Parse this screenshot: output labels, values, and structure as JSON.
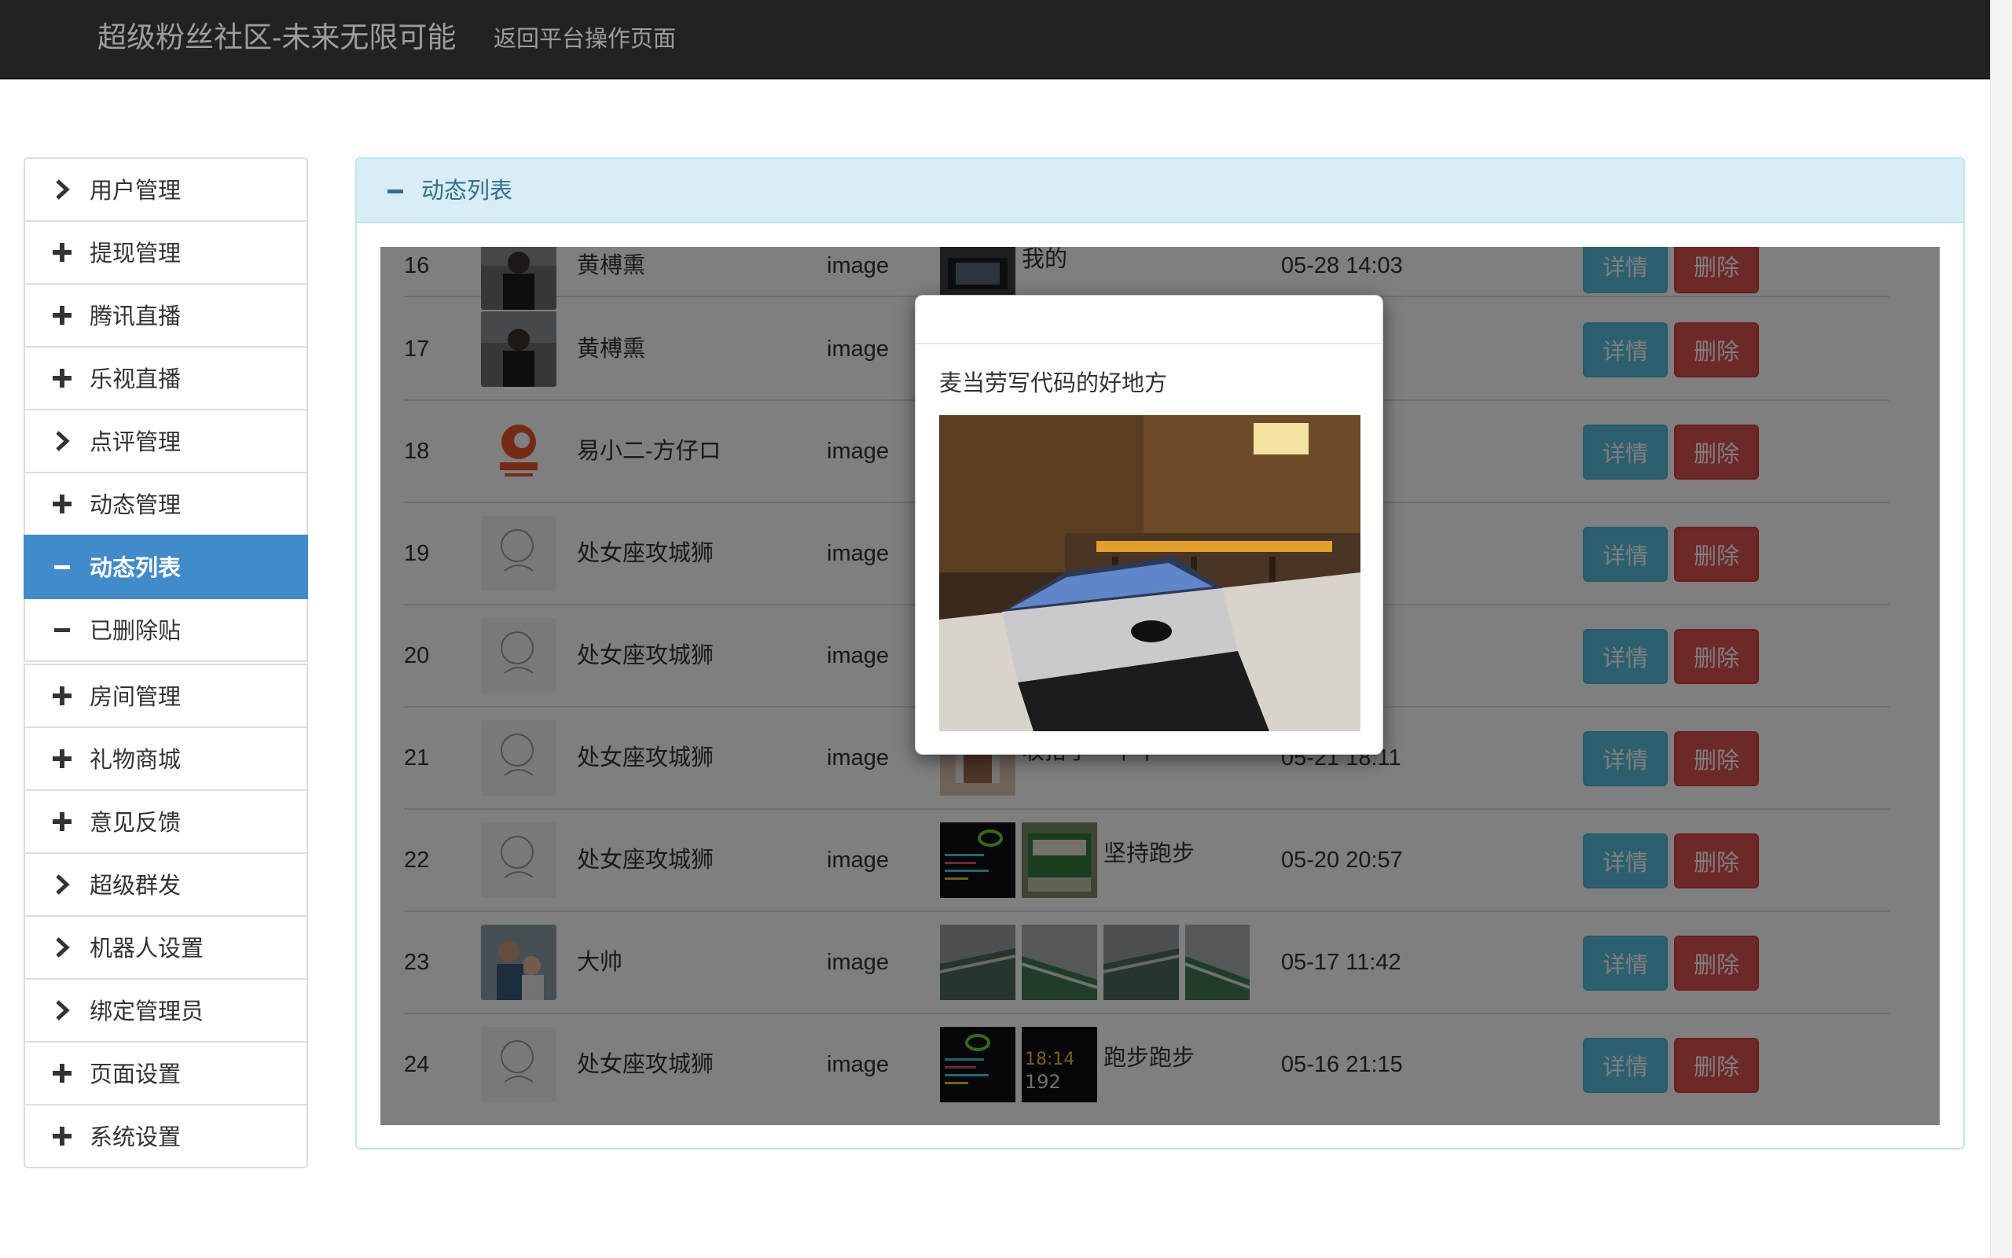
{
  "header": {
    "brand": "超级粉丝社区-未来无限可能",
    "back_link": "返回平台操作页面"
  },
  "sidebar": {
    "items": [
      {
        "label": "用户管理",
        "icon": "chevron-right-icon"
      },
      {
        "label": "提现管理",
        "icon": "plus-icon"
      },
      {
        "label": "腾讯直播",
        "icon": "plus-icon"
      },
      {
        "label": "乐视直播",
        "icon": "plus-icon"
      },
      {
        "label": "点评管理",
        "icon": "chevron-right-icon"
      },
      {
        "label": "动态管理",
        "icon": "plus-icon"
      },
      {
        "label": "动态列表",
        "icon": "minus-icon",
        "active": true
      },
      {
        "label": "已删除贴",
        "icon": "minus-icon"
      },
      {
        "label": "房间管理",
        "icon": "plus-icon"
      },
      {
        "label": "礼物商城",
        "icon": "plus-icon"
      },
      {
        "label": "意见反馈",
        "icon": "plus-icon"
      },
      {
        "label": "超级群发",
        "icon": "chevron-right-icon"
      },
      {
        "label": "机器人设置",
        "icon": "chevron-right-icon"
      },
      {
        "label": "绑定管理员",
        "icon": "chevron-right-icon"
      },
      {
        "label": "页面设置",
        "icon": "plus-icon"
      },
      {
        "label": "系统设置",
        "icon": "plus-icon"
      }
    ]
  },
  "panel": {
    "title": "动态列表"
  },
  "buttons": {
    "detail": "详情",
    "delete": "删除"
  },
  "rows": [
    {
      "id": "16",
      "name": "黄榑熏",
      "type": "image",
      "text": "我的",
      "time": "05-28 14:03",
      "thumbs": 1
    },
    {
      "id": "17",
      "name": "黄榑熏",
      "type": "image",
      "text": "",
      "time": "",
      "thumbs": 0
    },
    {
      "id": "18",
      "name": "易小二-方仔ロ",
      "type": "image",
      "text": "",
      "time": "",
      "thumbs": 0
    },
    {
      "id": "19",
      "name": "处女座攻城狮",
      "type": "image",
      "text": "",
      "time": "",
      "thumbs": 0
    },
    {
      "id": "20",
      "name": "处女座攻城狮",
      "type": "image",
      "text": "",
      "time": "",
      "thumbs": 0
    },
    {
      "id": "21",
      "name": "处女座攻城狮",
      "type": "image",
      "text": "收拾了一下午",
      "time": "05-21 18:11",
      "thumbs": 1
    },
    {
      "id": "22",
      "name": "处女座攻城狮",
      "type": "image",
      "text": "坚持跑步",
      "time": "05-20 20:57",
      "thumbs": 2
    },
    {
      "id": "23",
      "name": "大帅",
      "type": "image",
      "text": "",
      "time": "05-17 11:42",
      "thumbs": 4
    },
    {
      "id": "24",
      "name": "处女座攻城狮",
      "type": "image",
      "text": "跑步跑步",
      "time": "05-16 21:15",
      "thumbs": 2
    }
  ],
  "modal": {
    "text": "麦当劳写代码的好地方"
  },
  "thumb_texts": {
    "watch_time": "18:14",
    "watch_value": "192"
  },
  "colors": {
    "primary": "#428bca",
    "info": "#5bc0de",
    "danger": "#d9534f",
    "panel_head": "#d9edf7",
    "topbar": "#222222"
  }
}
